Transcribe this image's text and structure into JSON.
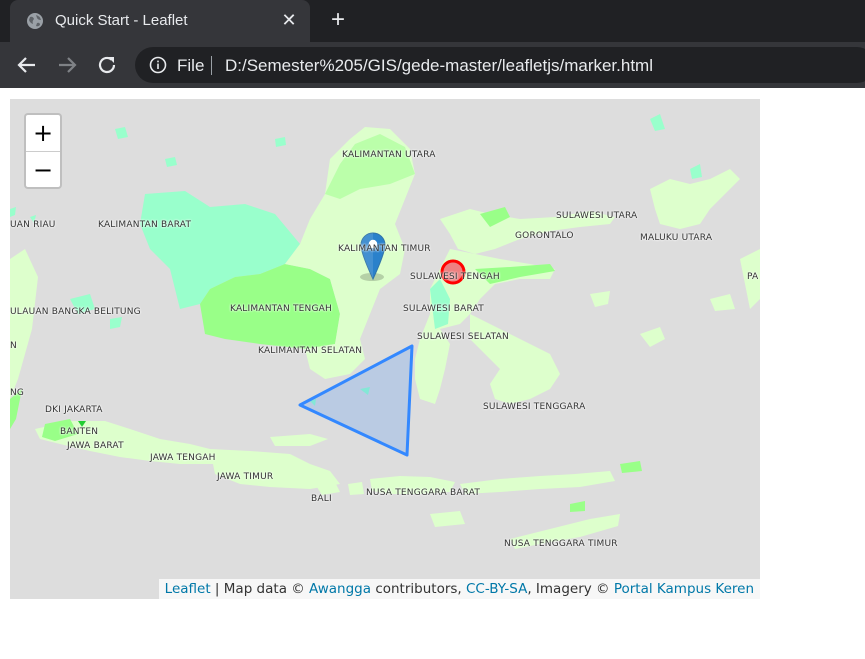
{
  "browser": {
    "tab_title": "Quick Start - Leaflet",
    "close_symbol": "✕",
    "new_tab_symbol": "+",
    "scheme": "File",
    "url": "D:/Semester%205/GIS/gede-master/leafletjs/marker.html",
    "icons": [
      "globe-icon",
      "close-icon",
      "plus-icon",
      "back-arrow-icon",
      "forward-arrow-icon",
      "reload-icon",
      "info-icon"
    ]
  },
  "map": {
    "zoom_in": "+",
    "zoom_out": "−",
    "labels": [
      "KALIMANTAN UTARA",
      "UAN RIAU",
      "KALIMANTAN BARAT",
      "KALIMANTAN TIMUR",
      "SULAWESI UTARA",
      "GORONTALO",
      "MALUKU UTARA",
      "SULAWESI TENGAH",
      "PA",
      "ULAUAN BANGKA BELITUNG",
      "KALIMANTAN TENGAH",
      "SULAWESI BARAT",
      "N",
      "SULAWESI SELATAN",
      "KALIMANTAN SELATAN",
      "NG",
      "DKI JAKARTA",
      "SULAWESI TENGGARA",
      "BANTEN",
      "JAWA BARAT",
      "JAWA TENGAH",
      "JAWA TIMUR",
      "BALI",
      "NUSA TENGGARA BARAT",
      "NUSA TENGGARA TIMUR"
    ],
    "marker": "map-marker-icon",
    "circle": {
      "stroke": "#ff0000",
      "fill": "#f03"
    },
    "polygon": {
      "stroke": "#3388ff",
      "fill": "#3388ff"
    },
    "colors": {
      "ocean": "#dddddd",
      "land_light": "#ddffcc",
      "land_mid": "#bbffaa",
      "land_green": "#99ff88",
      "land_teal": "#99ffcc"
    }
  },
  "attribution": {
    "leaflet": "Leaflet",
    "sep1": " | Map data © ",
    "awangga": "Awangga",
    "sep2": " contributors, ",
    "license": "CC-BY-SA",
    "sep3": ", Imagery © ",
    "portal": "Portal Kampus Keren"
  }
}
